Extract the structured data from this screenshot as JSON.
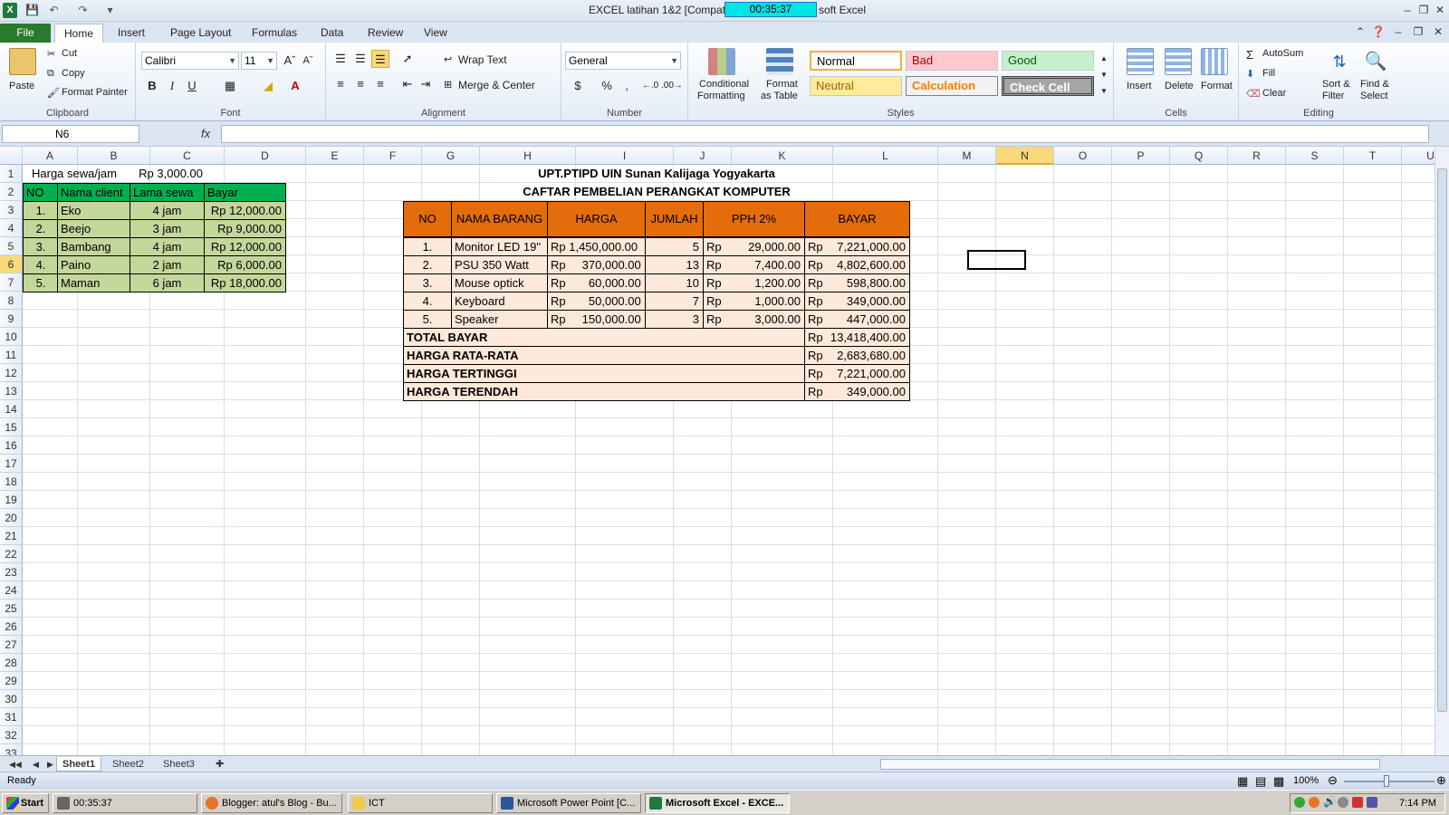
{
  "window": {
    "title_left": "EXCEL latihan 1&2  [Compatib",
    "title_right": "soft Excel",
    "timer": "00:35:37"
  },
  "ribbon_tabs": [
    "File",
    "Home",
    "Insert",
    "Page Layout",
    "Formulas",
    "Data",
    "Review",
    "View"
  ],
  "clipboard": {
    "paste": "Paste",
    "cut": "Cut",
    "copy": "Copy",
    "format_painter": "Format Painter",
    "label": "Clipboard"
  },
  "font": {
    "name": "Calibri",
    "size": "11",
    "bold": "B",
    "italic": "I",
    "underline": "U",
    "label": "Font"
  },
  "alignment": {
    "wrap": "Wrap Text",
    "merge": "Merge & Center",
    "label": "Alignment"
  },
  "number": {
    "format": "General",
    "currency": "$",
    "percent": "%",
    "comma": ",",
    "label": "Number"
  },
  "styles": {
    "conditional": "Conditional",
    "conditional2": "Formatting",
    "format_table": "Format",
    "format_table2": "as Table",
    "normal": "Normal",
    "bad": "Bad",
    "good": "Good",
    "neutral": "Neutral",
    "calculation": "Calculation",
    "check_cell": "Check Cell",
    "label": "Styles"
  },
  "cells_group": {
    "insert": "Insert",
    "delete": "Delete",
    "format": "Format",
    "label": "Cells"
  },
  "editing": {
    "autosum": "AutoSum",
    "fill": "Fill",
    "clear": "Clear",
    "sort": "Sort &",
    "sort2": "Filter",
    "find": "Find &",
    "find2": "Select",
    "label": "Editing"
  },
  "formula_bar": {
    "name_box": "N6",
    "fx": "fx",
    "content": ""
  },
  "columns": [
    "A",
    "B",
    "C",
    "D",
    "E",
    "F",
    "G",
    "H",
    "I",
    "J",
    "K",
    "L",
    "M",
    "N",
    "O",
    "P",
    "Q",
    "R",
    "S",
    "T",
    "U"
  ],
  "rows": [
    "1",
    "2",
    "3",
    "4",
    "5",
    "6",
    "7",
    "8",
    "9",
    "10",
    "11",
    "12",
    "13",
    "14",
    "15",
    "16",
    "17",
    "18",
    "19",
    "20",
    "21",
    "22",
    "23",
    "24",
    "25",
    "26",
    "27",
    "28",
    "29",
    "30",
    "31",
    "32",
    "33"
  ],
  "rent_table": {
    "rate_label": "Harga sewa/jam",
    "rate_value": "Rp 3,000.00",
    "headers": [
      "NO",
      "Nama client",
      "Lama sewa",
      "Bayar"
    ],
    "rows": [
      [
        "1.",
        "Eko",
        "4 jam",
        "Rp 12,000.00"
      ],
      [
        "2.",
        "Beejo",
        "3 jam",
        "Rp   9,000.00"
      ],
      [
        "3.",
        "Bambang",
        "4 jam",
        "Rp 12,000.00"
      ],
      [
        "4.",
        "Paino",
        "2 jam",
        "Rp   6,000.00"
      ],
      [
        "5.",
        "Maman",
        "6 jam",
        "Rp 18,000.00"
      ]
    ]
  },
  "purchase_table": {
    "title1": "UPT.PTIPD UIN Sunan Kalijaga Yogyakarta",
    "title2": "CAFTAR PEMBELIAN PERANGKAT KOMPUTER",
    "headers": [
      "NO",
      "NAMA BARANG",
      "HARGA",
      "JUMLAH",
      "PPH 2%",
      "BAYAR"
    ],
    "rows": [
      [
        "1.",
        "Monitor LED 19\"",
        "Rp 1,450,000.00",
        "5",
        "Rp",
        "29,000.00",
        "Rp",
        "7,221,000.00"
      ],
      [
        "2.",
        "PSU 350 Watt",
        "Rp     370,000.00",
        "13",
        "Rp",
        "7,400.00",
        "Rp",
        "4,802,600.00"
      ],
      [
        "3.",
        "Mouse optick",
        "Rp       60,000.00",
        "10",
        "Rp",
        "1,200.00",
        "Rp",
        "598,800.00"
      ],
      [
        "4.",
        "Keyboard",
        "Rp       50,000.00",
        "7",
        "Rp",
        "1,000.00",
        "Rp",
        "349,000.00"
      ],
      [
        "5.",
        "Speaker",
        "Rp     150,000.00",
        "3",
        "Rp",
        "3,000.00",
        "Rp",
        "447,000.00"
      ]
    ],
    "summary": [
      [
        "TOTAL BAYAR",
        "Rp",
        "13,418,400.00"
      ],
      [
        "HARGA RATA-RATA",
        "Rp",
        "2,683,680.00"
      ],
      [
        "HARGA TERTINGGI",
        "Rp",
        "7,221,000.00"
      ],
      [
        "HARGA TERENDAH",
        "Rp",
        "349,000.00"
      ]
    ]
  },
  "sheets": [
    "Sheet1",
    "Sheet2",
    "Sheet3"
  ],
  "status": {
    "ready": "Ready",
    "zoom": "100%"
  },
  "taskbar": {
    "start": "Start",
    "items": [
      "00:35:37",
      "Blogger: atul's Blog - Bu...",
      "ICT",
      "Microsoft Power Point [C...",
      "Microsoft Excel - EXCE..."
    ],
    "clock": "7:14 PM"
  }
}
